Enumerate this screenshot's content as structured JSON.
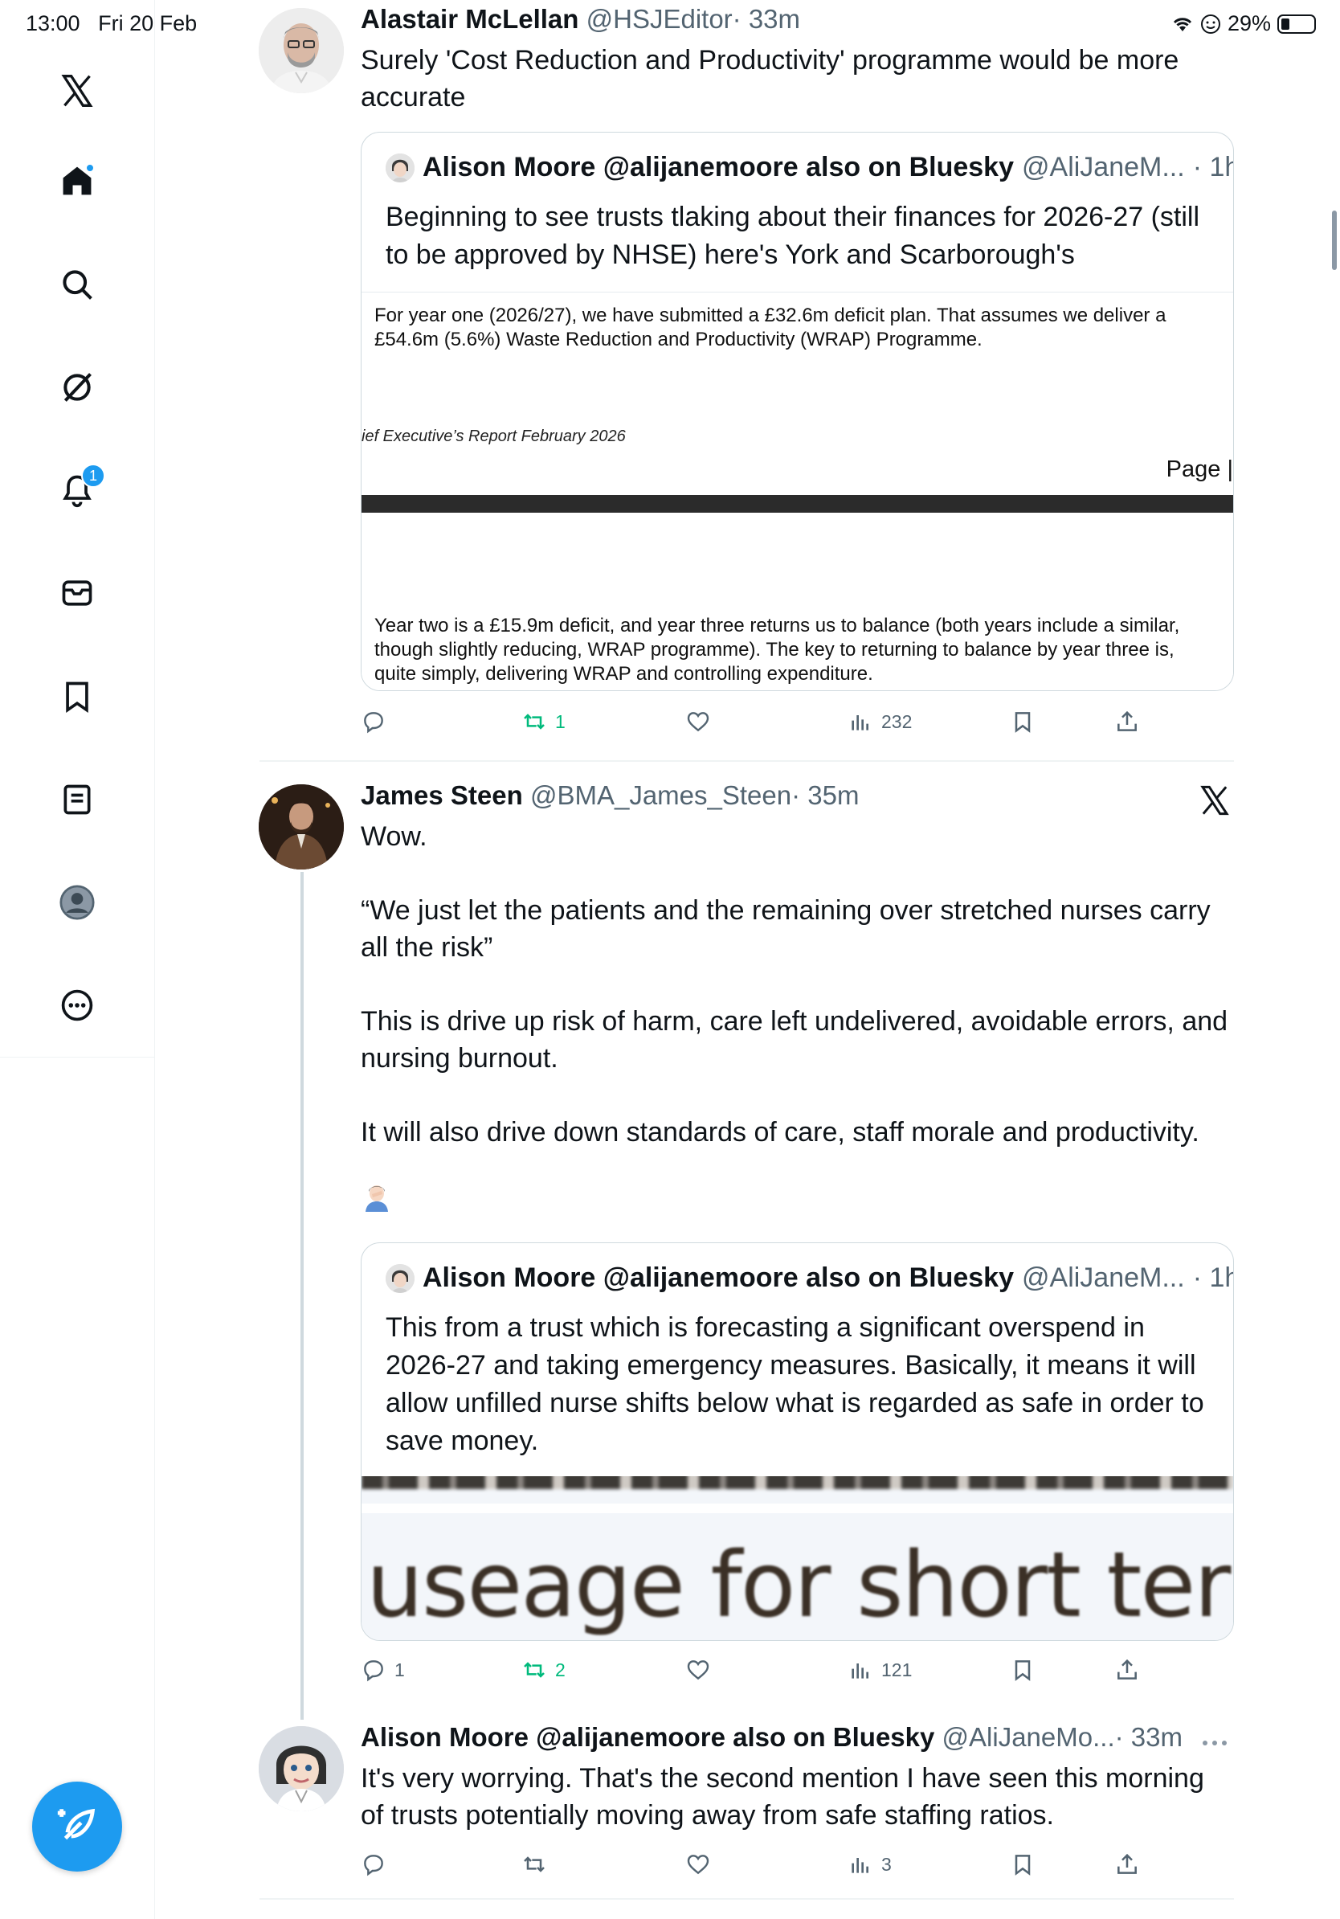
{
  "status_bar": {
    "time": "13:00",
    "date": "Fri 20 Feb",
    "battery": "29%"
  },
  "sidebar": {
    "notifications_badge": "1",
    "items": [
      "x-logo",
      "home",
      "search",
      "grok",
      "notifications",
      "messages",
      "bookmarks",
      "lists",
      "profile",
      "more"
    ]
  },
  "tweets": [
    {
      "name": "Alastair McLellan",
      "handle": "@HSJEditor",
      "time": "· 33m",
      "text": "Surely 'Cost Reduction and Productivity' programme would be more accurate",
      "quote": {
        "name": "Alison Moore @alijanemoore also on Bluesky",
        "handle": "@AliJaneM...",
        "time": "· 1h",
        "text": "Beginning to see trusts tlaking about their finances for 2026-27 (still to be approved by NHSE) here's York and Scarborough's",
        "image_text_1": "For year one (2026/27), we have submitted a £32.6m deficit plan. That assumes we deliver a £54.6m (5.6%) Waste Reduction and Productivity (WRAP) Programme.",
        "image_caption": "ief Executive’s Report February 2026",
        "image_page": "Page |",
        "image_text_2": "Year two is a £15.9m deficit, and year three returns us to balance (both years include a similar, though slightly reducing, WRAP programme). The key to returning to balance by year three is, quite simply, delivering WRAP and controlling expenditure."
      },
      "actions": {
        "replies": "",
        "reposts": "1",
        "likes": "",
        "views": "232"
      }
    },
    {
      "name": "James Steen",
      "handle": "@BMA_James_Steen",
      "time": "· 35m",
      "text": "Wow.\n\n“We just let the patients and the remaining over stretched nurses carry all the risk”\n\nThis is drive up risk of harm, care left undelivered, avoidable errors, and nursing burnout.\n\nIt will also drive down standards of care, staff morale and productivity.",
      "emoji": "🤦🏻‍♂️",
      "quote": {
        "name": "Alison Moore @alijanemoore also on Bluesky",
        "handle": "@AliJaneM...",
        "time": "· 1h",
        "text": "This from a trust which is forecasting a significant overspend in 2026-27 and taking emergency measures.  Basically, it means it will allow unfilled nurse shifts below what is regarded as safe in order to save money.",
        "image_text": "useage for short term"
      },
      "actions": {
        "replies": "1",
        "reposts": "2",
        "likes": "",
        "views": "121"
      }
    },
    {
      "name": "Alison Moore @alijanemoore also on Bluesky",
      "handle": "@AliJaneMo...",
      "time": "· 33m",
      "text": "It's very worrying. That's the second mention I have seen this morning of trusts potentially moving away from safe staffing ratios.",
      "actions": {
        "replies": "",
        "reposts": "",
        "likes": "",
        "views": "3"
      }
    }
  ],
  "colors": {
    "accent": "#1d9bf0",
    "repost_green": "#00ba7c",
    "muted": "#536471"
  }
}
